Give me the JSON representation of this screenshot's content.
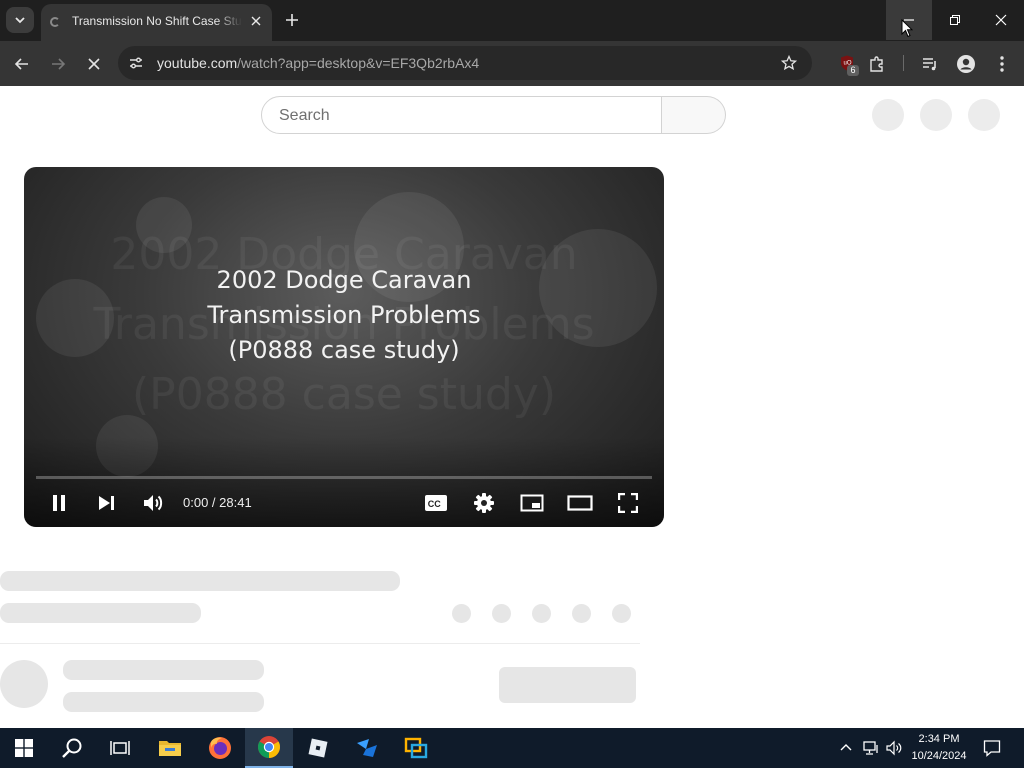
{
  "browser": {
    "tab": {
      "title": "Transmission No Shift Case Study",
      "close_icon": "close-icon"
    },
    "new_tab_label": "+",
    "address": {
      "domain": "youtube.com",
      "path": "/watch?app=desktop&v=EF3Qb2rbAx4"
    },
    "extension_badge_count": "6"
  },
  "page": {
    "search": {
      "placeholder": "Search",
      "value": ""
    },
    "video": {
      "title_lines": [
        "2002 Dodge Caravan",
        "Transmission Problems",
        "(P0888 case study)"
      ],
      "time_current": "0:00",
      "time_total": "28:41",
      "time_display": "0:00 / 28:41",
      "progress_fraction": 0.0
    }
  },
  "taskbar": {
    "time": "2:34 PM",
    "date": "10/24/2024",
    "apps": [
      "start",
      "search",
      "task-view",
      "file-explorer",
      "firefox",
      "chrome",
      "roblox-player",
      "roblox-studio",
      "multitasking-app"
    ],
    "active_app": "chrome"
  },
  "colors": {
    "youtube_red": "#ff0000",
    "chrome_dark": "#1f1f1f",
    "taskbar": "#0f1b2a"
  }
}
